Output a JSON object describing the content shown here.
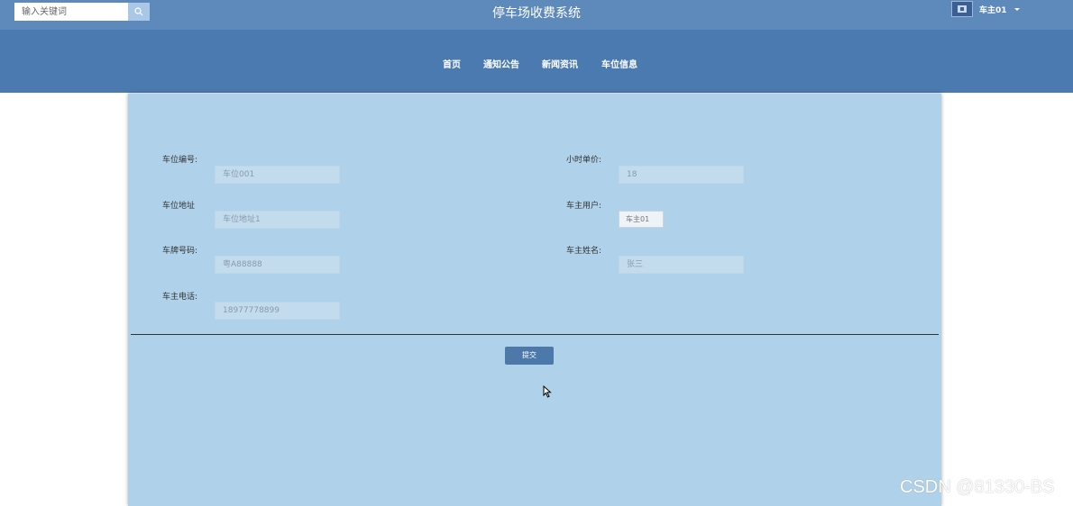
{
  "header": {
    "search_placeholder": "输入关键词",
    "site_title": "停车场收费系统",
    "user_name": "车主01",
    "colors": {
      "topbar": "#5e89bb",
      "navbar": "#4a7aaf",
      "panel": "#afd2ea"
    }
  },
  "nav": {
    "items": [
      {
        "label": "首页"
      },
      {
        "label": "通知公告"
      },
      {
        "label": "新闻资讯"
      },
      {
        "label": "车位信息"
      }
    ]
  },
  "form": {
    "fields": {
      "space_no": {
        "label": "车位编号:",
        "value": "车位001"
      },
      "hourly_price": {
        "label": "小时单价:",
        "value": "18"
      },
      "space_address": {
        "label": "车位地址",
        "value": "车位地址1"
      },
      "owner_user": {
        "label": "车主用户:",
        "value": "车主01"
      },
      "plate_no": {
        "label": "车牌号码:",
        "value": "粤A88888"
      },
      "owner_name": {
        "label": "车主姓名:",
        "value": "张三"
      },
      "owner_phone": {
        "label": "车主电话:",
        "value": "18977778899"
      }
    },
    "submit_label": "提交"
  },
  "watermark": "CSDN @81330-BS"
}
